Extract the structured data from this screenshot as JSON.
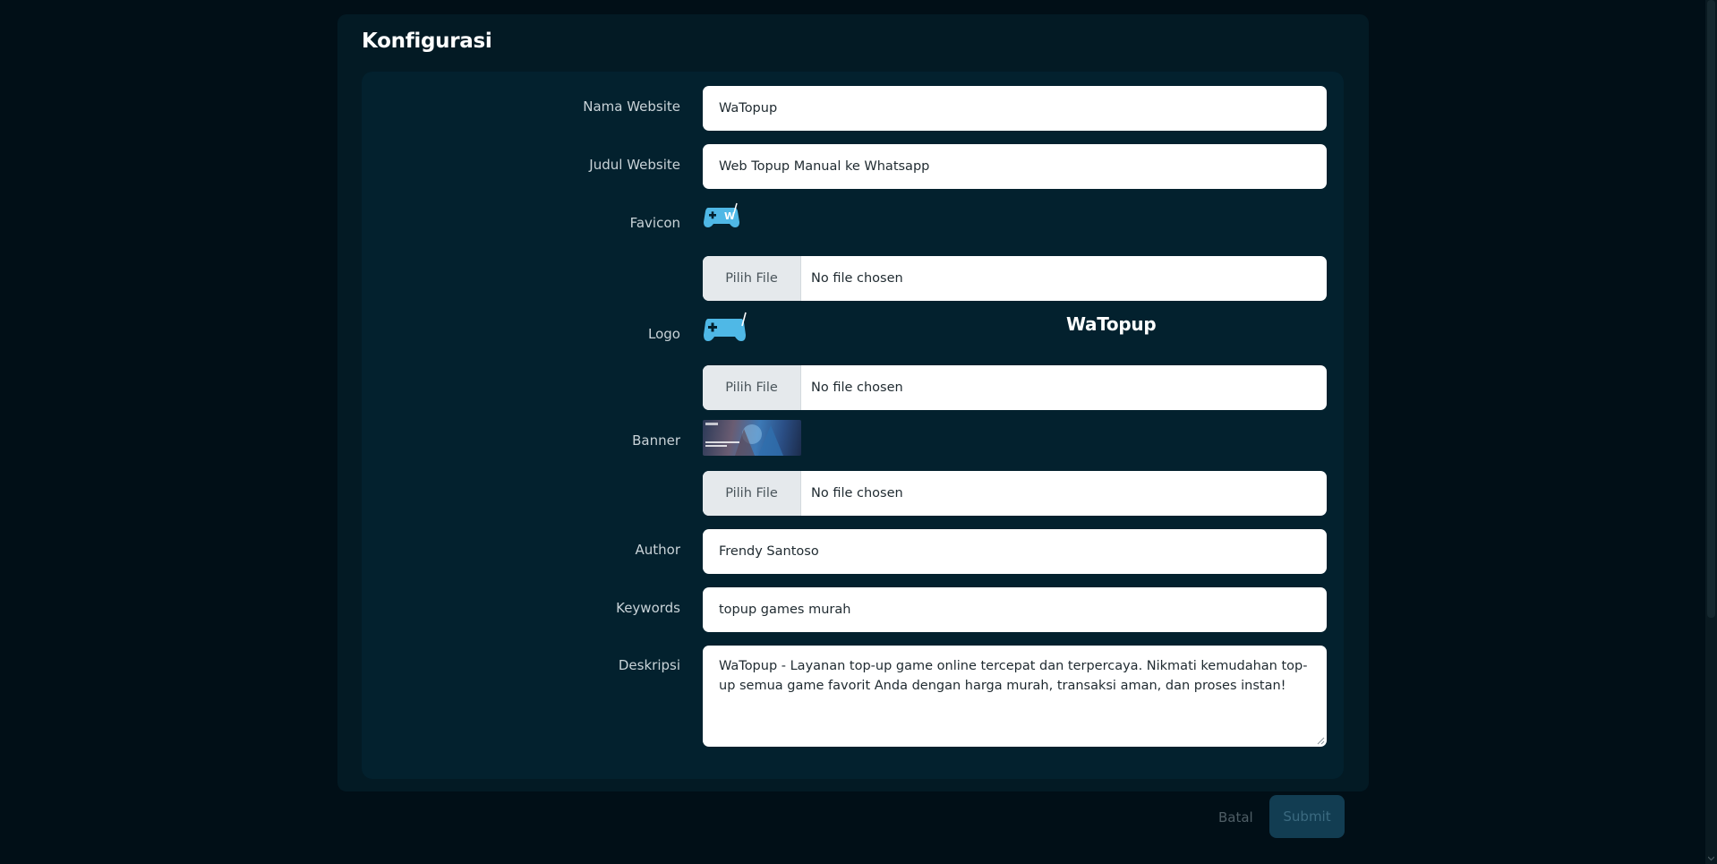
{
  "card": {
    "title": "Konfigurasi"
  },
  "fields": {
    "nama_website": {
      "label": "Nama Website",
      "value": "WaTopup"
    },
    "judul_website": {
      "label": "Judul Website",
      "value": "Web Topup Manual ke Whatsapp"
    },
    "favicon": {
      "label": "Favicon",
      "button": "Pilih File",
      "status": "No file chosen",
      "preview_icon": "gamepad-w-icon"
    },
    "logo": {
      "label": "Logo",
      "button": "Pilih File",
      "status": "No file chosen",
      "preview_text": "WaTopup"
    },
    "banner": {
      "label": "Banner",
      "button": "Pilih File",
      "status": "No file chosen"
    },
    "author": {
      "label": "Author",
      "value": "Frendy Santoso"
    },
    "keywords": {
      "label": "Keywords",
      "value": "topup games murah"
    },
    "deskripsi": {
      "label": "Deskripsi",
      "value": "WaTopup - Layanan top-up game online tercepat dan terpercaya. Nikmati kemudahan top-up semua game favorit Anda dengan harga murah, transaksi aman, dan proses instan!"
    }
  },
  "actions": {
    "cancel": "Batal",
    "submit": "Submit"
  },
  "colors": {
    "background": "#010f17",
    "card": "#031a24",
    "form_box": "#03212e",
    "brand_blue": "#4fb8e6",
    "submit_bg": "#123d52"
  }
}
